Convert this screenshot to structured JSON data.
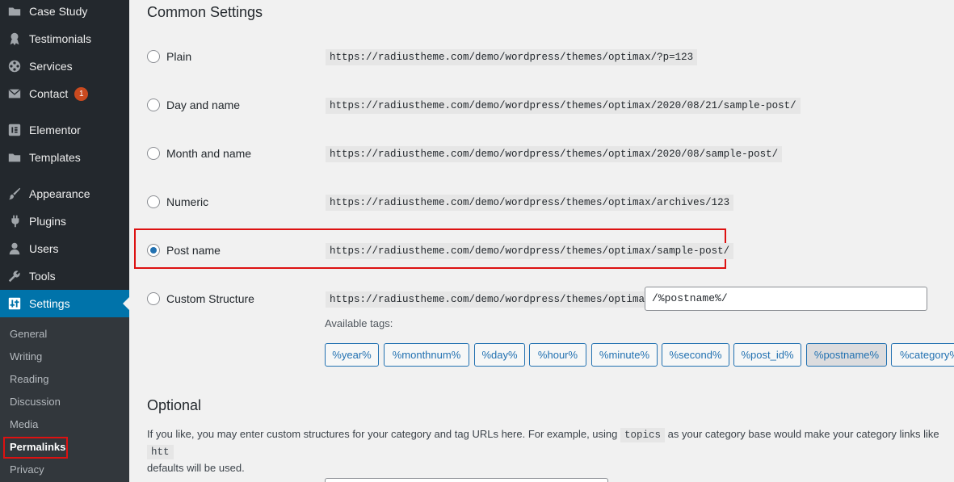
{
  "sidebar": {
    "items": [
      {
        "label": "Case Study",
        "icon": "folder-icon"
      },
      {
        "label": "Testimonials",
        "icon": "award-icon"
      },
      {
        "label": "Services",
        "icon": "film-reel-icon"
      },
      {
        "label": "Contact",
        "icon": "envelope-icon",
        "badge": "1"
      },
      {
        "label": "Elementor",
        "icon": "elementor-icon"
      },
      {
        "label": "Templates",
        "icon": "folder-icon"
      },
      {
        "label": "Appearance",
        "icon": "paintbrush-icon"
      },
      {
        "label": "Plugins",
        "icon": "plugin-icon"
      },
      {
        "label": "Users",
        "icon": "user-icon"
      },
      {
        "label": "Tools",
        "icon": "wrench-icon"
      },
      {
        "label": "Settings",
        "icon": "settings-sliders-icon"
      }
    ],
    "submenu": [
      "General",
      "Writing",
      "Reading",
      "Discussion",
      "Media",
      "Permalinks",
      "Privacy"
    ]
  },
  "main": {
    "common_settings_title": "Common Settings",
    "options": [
      {
        "label": "Plain",
        "url": "https://radiustheme.com/demo/wordpress/themes/optimax/?p=123",
        "checked": false
      },
      {
        "label": "Day and name",
        "url": "https://radiustheme.com/demo/wordpress/themes/optimax/2020/08/21/sample-post/",
        "checked": false
      },
      {
        "label": "Month and name",
        "url": "https://radiustheme.com/demo/wordpress/themes/optimax/2020/08/sample-post/",
        "checked": false
      },
      {
        "label": "Numeric",
        "url": "https://radiustheme.com/demo/wordpress/themes/optimax/archives/123",
        "checked": false
      },
      {
        "label": "Post name",
        "url": "https://radiustheme.com/demo/wordpress/themes/optimax/sample-post/",
        "checked": true
      },
      {
        "label": "Custom Structure",
        "url": "https://radiustheme.com/demo/wordpress/themes/optimax",
        "checked": false
      }
    ],
    "custom_structure_value": "/%postname%/",
    "available_tags_label": "Available tags:",
    "tags": [
      "%year%",
      "%monthnum%",
      "%day%",
      "%hour%",
      "%minute%",
      "%second%",
      "%post_id%",
      "%postname%",
      "%category%"
    ],
    "optional_title": "Optional",
    "optional_text_1": "If you like, you may enter custom structures for your category and tag URLs here. For example, using",
    "optional_code": "topics",
    "optional_text_2": "as your category base would make your category links like",
    "optional_code_2": "htt",
    "optional_text_3": "defaults will be used."
  }
}
